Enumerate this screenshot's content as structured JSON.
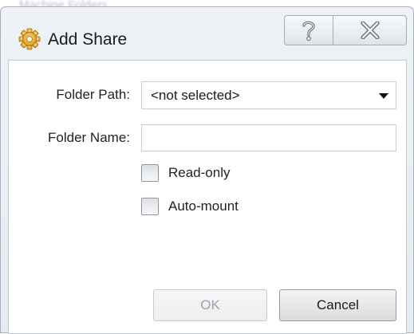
{
  "background": {
    "ghost_title": "Machine Folders"
  },
  "dialog": {
    "title": "Add Share",
    "title_icon": "gear-icon",
    "help_icon": "help-icon",
    "close_icon": "close-icon"
  },
  "form": {
    "folder_path_label": "Folder Path:",
    "folder_path_value": "<not selected>",
    "folder_name_label": "Folder Name:",
    "folder_name_value": "",
    "read_only_label": "Read-only",
    "read_only_checked": false,
    "auto_mount_label": "Auto-mount",
    "auto_mount_checked": false
  },
  "buttons": {
    "ok_label": "OK",
    "ok_enabled": false,
    "cancel_label": "Cancel"
  }
}
